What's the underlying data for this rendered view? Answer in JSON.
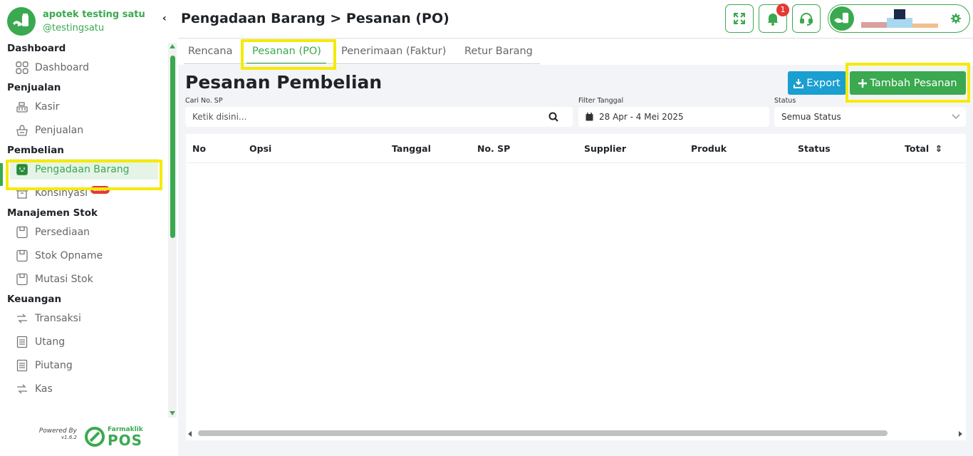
{
  "sidebar": {
    "brand_name": "apotek testing satu",
    "brand_user": "@testingsatu",
    "collapse_icon": "‹",
    "sections": [
      {
        "title": "Dashboard",
        "items": [
          {
            "label": "Dashboard",
            "icon": "grid-icon"
          }
        ]
      },
      {
        "title": "Penjualan",
        "items": [
          {
            "label": "Kasir",
            "icon": "cash-register-icon"
          },
          {
            "label": "Penjualan",
            "icon": "basket-icon"
          }
        ]
      },
      {
        "title": "Pembelian",
        "items": [
          {
            "label": "Pengadaan Barang",
            "icon": "procurement-icon",
            "active": true
          },
          {
            "label": "Konsinyasi",
            "icon": "archive-icon",
            "badge": "BARU"
          }
        ]
      },
      {
        "title": "Manajemen Stok",
        "items": [
          {
            "label": "Persediaan",
            "icon": "box-icon"
          },
          {
            "label": "Stok Opname",
            "icon": "box-icon"
          },
          {
            "label": "Mutasi Stok",
            "icon": "box-icon"
          }
        ]
      },
      {
        "title": "Keuangan",
        "items": [
          {
            "label": "Transaksi",
            "icon": "transfer-icon"
          },
          {
            "label": "Utang",
            "icon": "receipt-icon"
          },
          {
            "label": "Piutang",
            "icon": "receipt-icon"
          },
          {
            "label": "Kas",
            "icon": "transfer-icon"
          }
        ]
      }
    ],
    "powered_by": "Powered By",
    "version": "v1.6.2",
    "product_top": "Farmaklik",
    "product_bottom": "POS"
  },
  "header": {
    "title": "Pengadaan Barang > Pesanan (PO)",
    "notification_count": "1",
    "icons": [
      "fullscreen-icon",
      "bell-icon",
      "headset-icon",
      "settings-icon"
    ]
  },
  "tabs": [
    {
      "label": "Rencana"
    },
    {
      "label": "Pesanan (PO)",
      "active": true
    },
    {
      "label": "Penerimaan (Faktur)"
    },
    {
      "label": "Retur Barang"
    }
  ],
  "main": {
    "heading": "Pesanan Pembelian",
    "export_label": "Export",
    "add_label": "Tambah Pesanan",
    "search_label": "Cari No. SP",
    "search_placeholder": "Ketik disini...",
    "date_label": "Filter Tanggal",
    "date_value": "28 Apr - 4 Mei 2025",
    "status_label": "Status",
    "status_value": "Semua Status"
  },
  "table": {
    "columns": [
      "No",
      "Opsi",
      "Tanggal",
      "No. SP",
      "Supplier",
      "Produk",
      "Status",
      "Total"
    ],
    "sort_icon": "⇕"
  },
  "colors": {
    "accent": "#3aa94f",
    "export": "#1a9fd0",
    "highlight": "#f5ea00",
    "badge": "#e53935"
  }
}
